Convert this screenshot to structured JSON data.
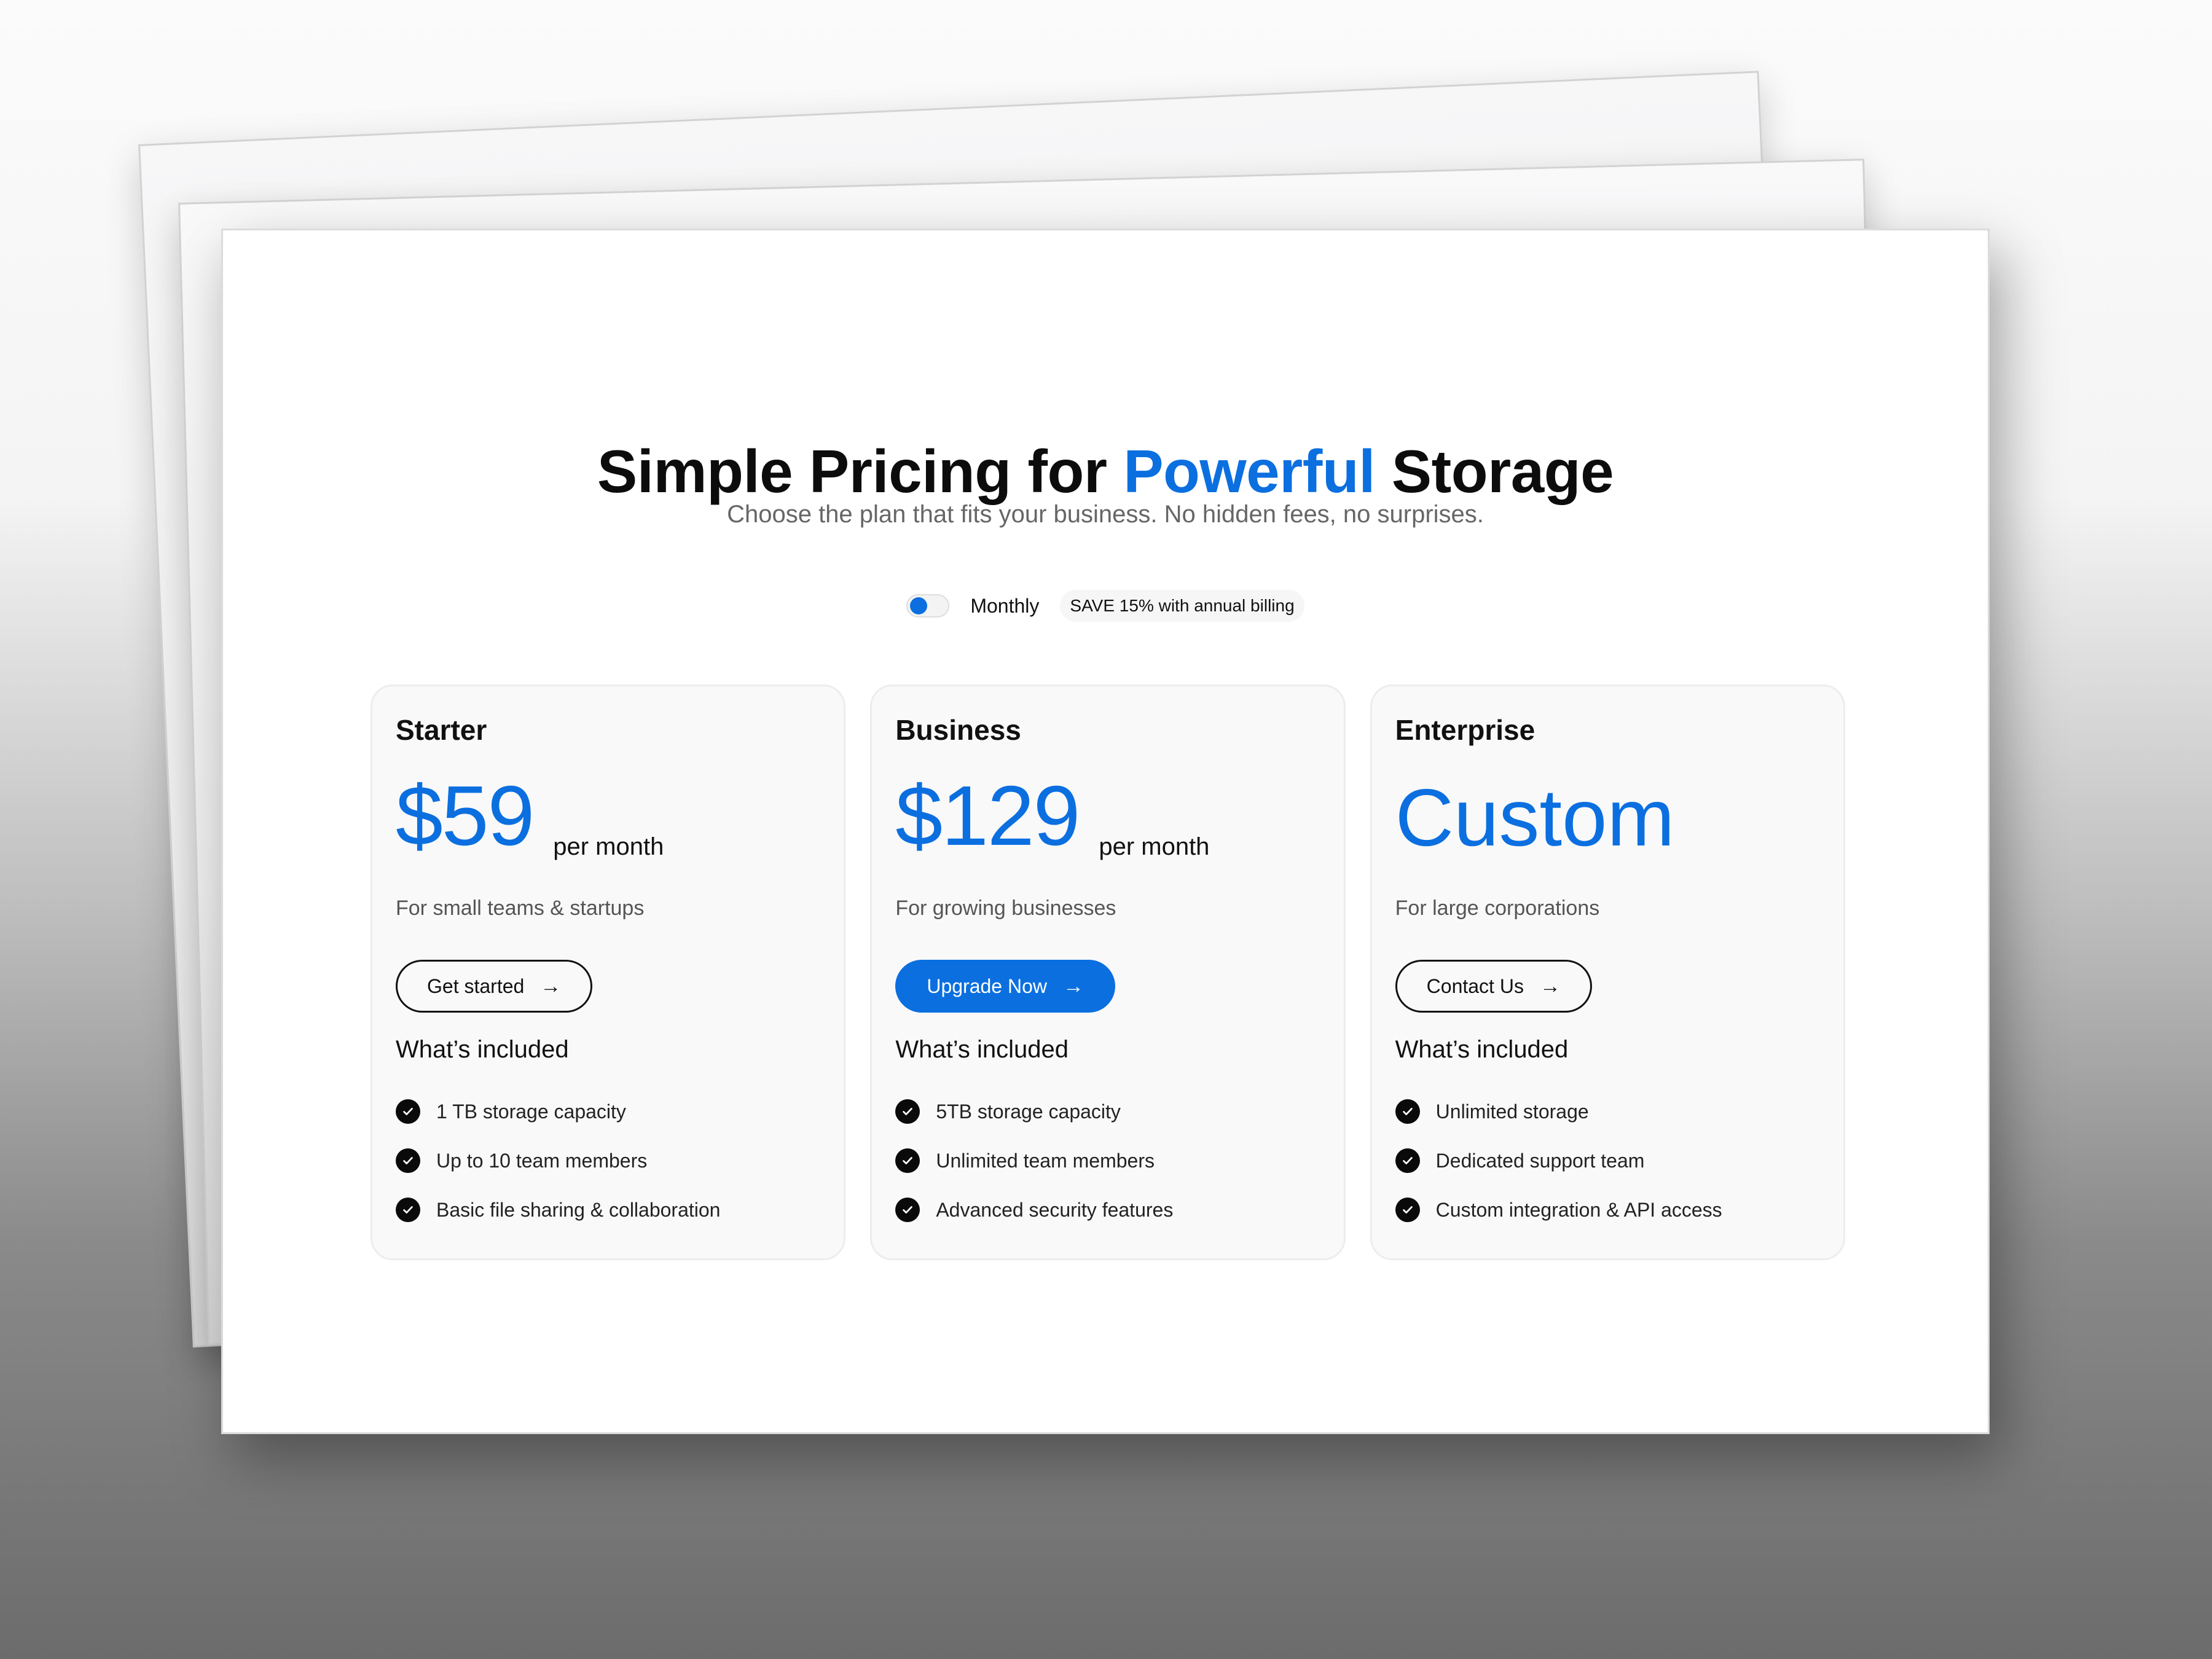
{
  "hero": {
    "title_before": "Simple Pricing for ",
    "title_accent": "Powerful",
    "title_after": " Storage",
    "subtitle": "Choose the plan that fits your business. No hidden fees, no surprises."
  },
  "billing": {
    "toggle_state": "monthly",
    "label": "Monthly",
    "badge": "SAVE 15% with annual billing"
  },
  "colors": {
    "accent": "#0b6fe0",
    "text": "#0c0c0c",
    "muted": "#666666"
  },
  "plans": [
    {
      "name": "Starter",
      "price": "$59",
      "period": "per month",
      "description": "For small teams & startups",
      "cta": "Get started",
      "cta_icon": "arrow-right-icon",
      "included_heading": "What’s included",
      "features": [
        "1 TB storage capacity",
        "Up to 10 team members",
        "Basic file sharing & collaboration"
      ]
    },
    {
      "name": "Business",
      "price": "$129",
      "period": "per month",
      "description": "For growing businesses",
      "cta": "Upgrade Now",
      "cta_icon": "arrow-right-icon",
      "included_heading": "What’s included",
      "features": [
        "5TB storage capacity",
        "Unlimited team members",
        "Advanced security features"
      ]
    },
    {
      "name": "Enterprise",
      "price": "Custom",
      "period": "",
      "description": "For large corporations",
      "cta": "Contact Us",
      "cta_icon": "arrow-right-icon",
      "included_heading": "What’s included",
      "features": [
        "Unlimited storage",
        "Dedicated support team",
        "Custom integration & API access"
      ]
    }
  ]
}
